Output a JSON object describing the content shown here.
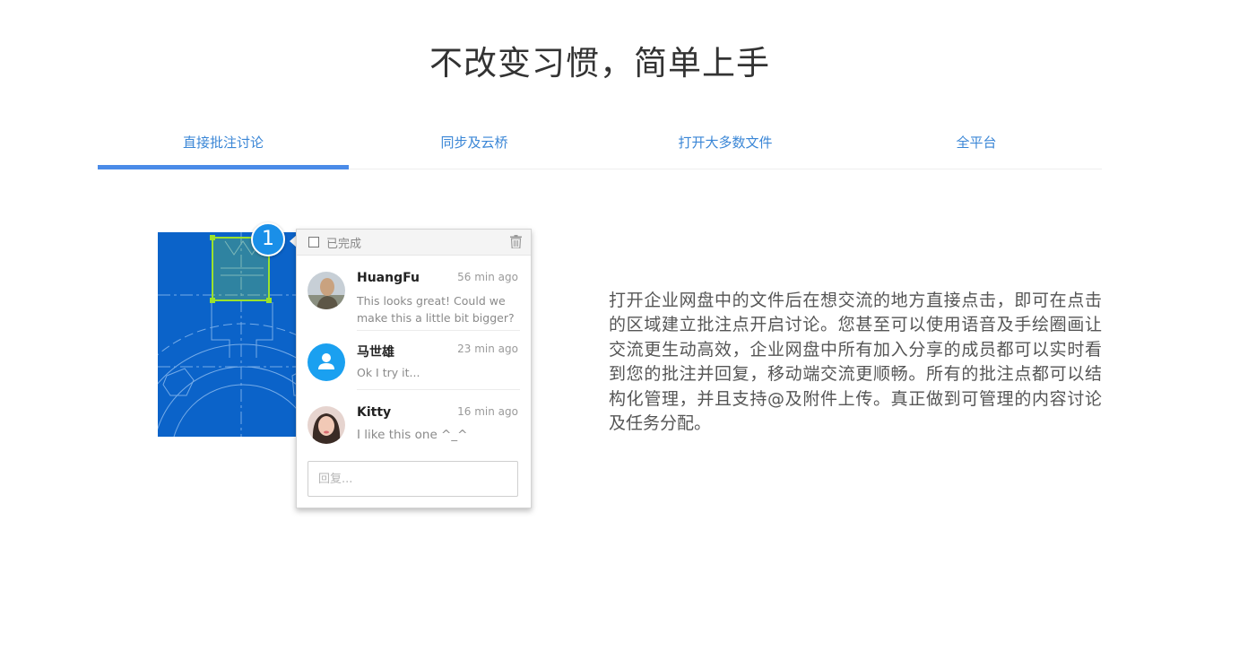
{
  "title": "不改变习惯，简单上手",
  "tabs": [
    {
      "label": "直接批注讨论",
      "active": true
    },
    {
      "label": "同步及云桥",
      "active": false
    },
    {
      "label": "打开大多数文件",
      "active": false
    },
    {
      "label": "全平台",
      "active": false
    }
  ],
  "colors": {
    "accent": "#4a8be8",
    "tab_text": "#3a86d6",
    "blueprint": "#0b63c9",
    "marker": "#1a8fe8",
    "selection": "#9be22d"
  },
  "marker": {
    "number": "1"
  },
  "popup": {
    "done_label": "已完成",
    "comments": [
      {
        "name": "HuangFu",
        "time": "56 min ago",
        "text": "This looks great! Could we make this a little bit bigger?",
        "avatar": "photo-avatar-man"
      },
      {
        "name": "马世雄",
        "time": "23 min ago",
        "text": "Ok I try it...",
        "avatar": "default-user-avatar"
      },
      {
        "name": "Kitty",
        "time": "16 min ago",
        "text": "I like this one ^_^",
        "avatar": "photo-avatar-woman"
      }
    ],
    "reply_placeholder": "回复..."
  },
  "description": "打开企业网盘中的文件后在想交流的地方直接点击，即可在点击的区域建立批注点开启讨论。您甚至可以使用语音及手绘圈画让交流更生动高效，企业网盘中所有加入分享的成员都可以实时看到您的批注并回复，移动端交流更顺畅。所有的批注点都可以结构化管理，并且支持@及附件上传。真正做到可管理的内容讨论及任务分配。"
}
